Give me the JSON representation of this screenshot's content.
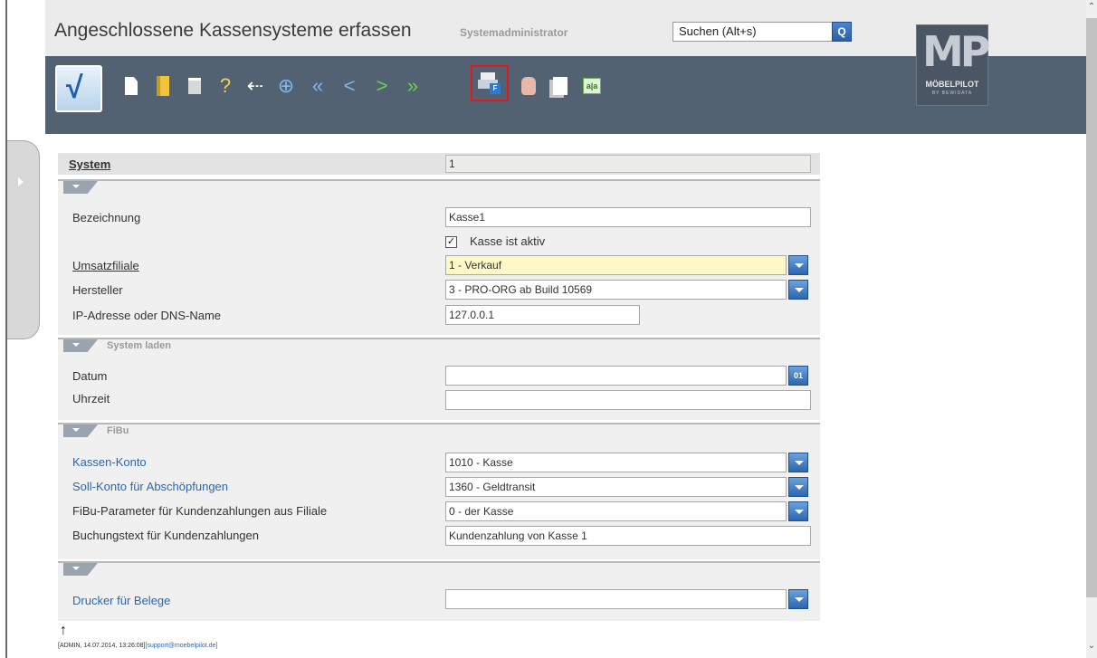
{
  "header": {
    "title": "Angeschlossene Kassensysteme erfassen",
    "subtitle": "Systemadministrator",
    "search_value": "Suchen (Alt+s)",
    "logo_mp": "MP",
    "logo_brand": "MÖBELPILOT",
    "logo_sub": "BY BEWIDATA"
  },
  "toolbar": {
    "icons": [
      "save-check-icon",
      "new-document-icon",
      "open-door-icon",
      "trash-icon",
      "help-icon",
      "back-icon",
      "search-icon",
      "first-icon",
      "previous-icon",
      "next-icon",
      "last-icon",
      "print-form-icon",
      "stop-hand-icon",
      "copy-documents-icon",
      "translate-icon"
    ],
    "help_glyph": "?",
    "back_glyph": "⇠",
    "first_glyph": "«",
    "prev_glyph": "<",
    "next_glyph": ">",
    "last_glyph": "»",
    "print_badge": "F",
    "translate_label": "a|a",
    "highlighted": "print-form-icon",
    "highlight_color": "#e01a1a"
  },
  "form": {
    "system": {
      "label": "System",
      "value": "1"
    },
    "main": {
      "bezeichnung_label": "Bezeichnung",
      "bezeichnung_value": "Kasse1",
      "aktiv_checked": "✓",
      "aktiv_label": "Kasse ist aktiv",
      "umsatzfiliale_label": "Umsatzfiliale",
      "umsatzfiliale_value": "1 - Verkauf",
      "hersteller_label": "Hersteller",
      "hersteller_value": "3 - PRO-ORG ab Build 10569",
      "ip_label": "IP-Adresse oder DNS-Name",
      "ip_value": "127.0.0.1"
    },
    "system_laden": {
      "title": "System laden",
      "datum_label": "Datum",
      "datum_value": "",
      "uhrzeit_label": "Uhrzeit",
      "uhrzeit_value": "",
      "calendar_glyph": "01"
    },
    "fibu": {
      "title": "FiBu",
      "kassen_konto_label": "Kassen-Konto",
      "kassen_konto_value": "1010 - Kasse",
      "soll_konto_label": "Soll-Konto für Abschöpfungen",
      "soll_konto_value": "1360 - Geldtransit",
      "param_label": "FiBu-Parameter für Kundenzahlungen aus Filiale",
      "param_value": "0 - der Kasse",
      "buchungstext_label": "Buchungstext für Kundenzahlungen",
      "buchungstext_value": "Kundenzahlung von Kasse 1"
    },
    "druck": {
      "drucker_label": "Drucker für Belege",
      "drucker_value": ""
    }
  },
  "footer": {
    "arrow": "↑",
    "info": "[ADMIN, 14.07.2014, 13:26:08]",
    "mail": "[support@moebelpilot.de]"
  },
  "colors": {
    "header_bg": "#536272",
    "accent_blue": "#2b66b0",
    "highlight_field": "#fdf8c6",
    "link_label": "#2a67b6"
  }
}
